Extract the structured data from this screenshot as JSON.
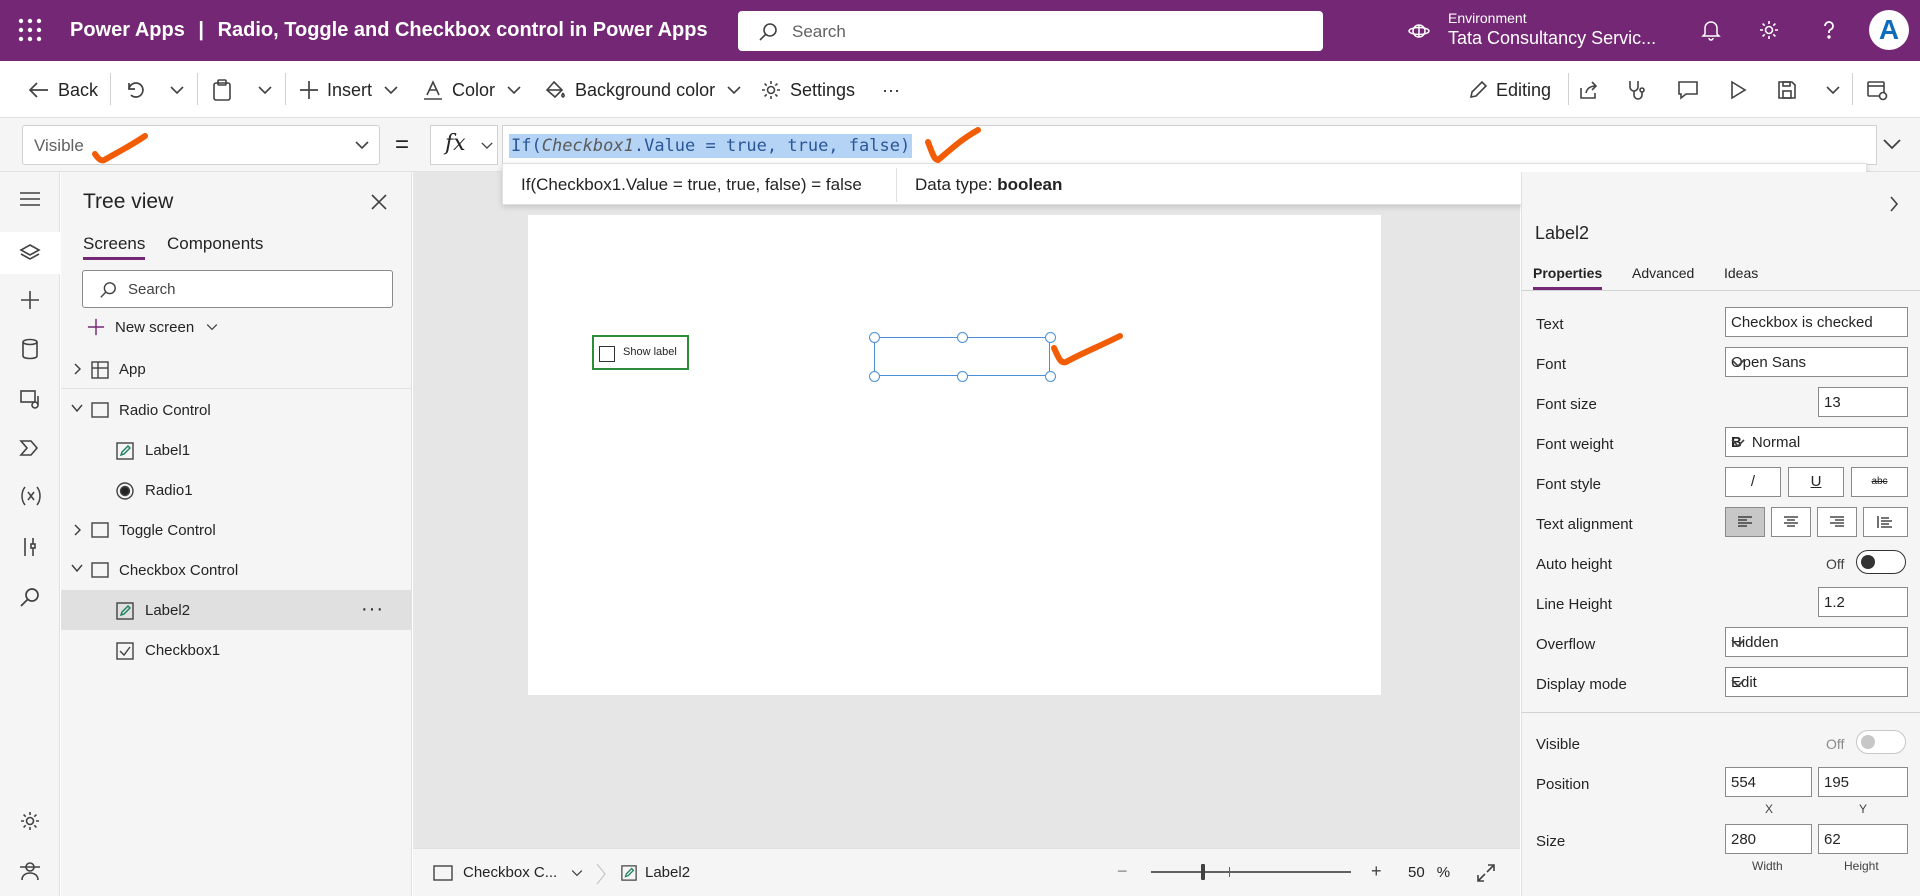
{
  "header": {
    "app_name": "Power Apps",
    "separator": "|",
    "doc_title": "Radio, Toggle and Checkbox control in Power Apps",
    "search_placeholder": "Search",
    "environment_label": "Environment",
    "environment_name": "Tata Consultancy Servic...",
    "avatar_letter": "A",
    "bg_color": "#742774"
  },
  "commands": {
    "back": "Back",
    "insert": "Insert",
    "color": "Color",
    "background_color": "Background color",
    "settings": "Settings",
    "more": "···",
    "editing": "Editing"
  },
  "formula": {
    "property": "Visible",
    "equals": "=",
    "fx": "fx",
    "text_prefix": "If(",
    "text_control": "Checkbox1",
    "text_suffix": ".Value = true, true, false)",
    "result": "If(Checkbox1.Value = true, true, false)  =  false",
    "data_type_label": "Data type: ",
    "data_type_value": "boolean"
  },
  "tree": {
    "title": "Tree view",
    "tabs": [
      "Screens",
      "Components"
    ],
    "search_placeholder": "Search",
    "new_screen": "New screen",
    "items": [
      {
        "label": "App"
      },
      {
        "label": "Radio Control"
      },
      {
        "label": "Label1"
      },
      {
        "label": "Radio1"
      },
      {
        "label": "Toggle Control"
      },
      {
        "label": "Checkbox Control"
      },
      {
        "label": "Label2"
      },
      {
        "label": "Checkbox1"
      }
    ],
    "more": "···"
  },
  "canvas": {
    "checkbox_label": "Show label"
  },
  "statusbar": {
    "screen": "Checkbox C...",
    "control": "Label2",
    "zoom_minus": "−",
    "zoom_plus": "+",
    "zoom_value": "50",
    "zoom_unit": "%"
  },
  "props": {
    "control_name": "Label2",
    "tabs": [
      "Properties",
      "Advanced",
      "Ideas"
    ],
    "text_label": "Text",
    "text_value": "Checkbox is checked",
    "font_label": "Font",
    "font_value": "Open Sans",
    "font_size_label": "Font size",
    "font_size_value": "13",
    "font_weight_label": "Font weight",
    "font_weight_prefix": "B",
    "font_weight_value": "Normal",
    "font_style_label": "Font style",
    "font_style_italic": "/",
    "font_style_underline": "U",
    "font_style_strike": "abc",
    "text_align_label": "Text alignment",
    "auto_height_label": "Auto height",
    "auto_height_state": "Off",
    "line_height_label": "Line Height",
    "line_height_value": "1.2",
    "overflow_label": "Overflow",
    "overflow_value": "Hidden",
    "display_mode_label": "Display mode",
    "display_mode_value": "Edit",
    "visible_label": "Visible",
    "visible_state": "Off",
    "position_label": "Position",
    "position_x": "554",
    "position_y": "195",
    "x_caption": "X",
    "y_caption": "Y",
    "size_label": "Size",
    "width_value": "280",
    "height_value": "62",
    "width_caption": "Width",
    "height_caption": "Height"
  },
  "annotation_color": "#f25c05"
}
